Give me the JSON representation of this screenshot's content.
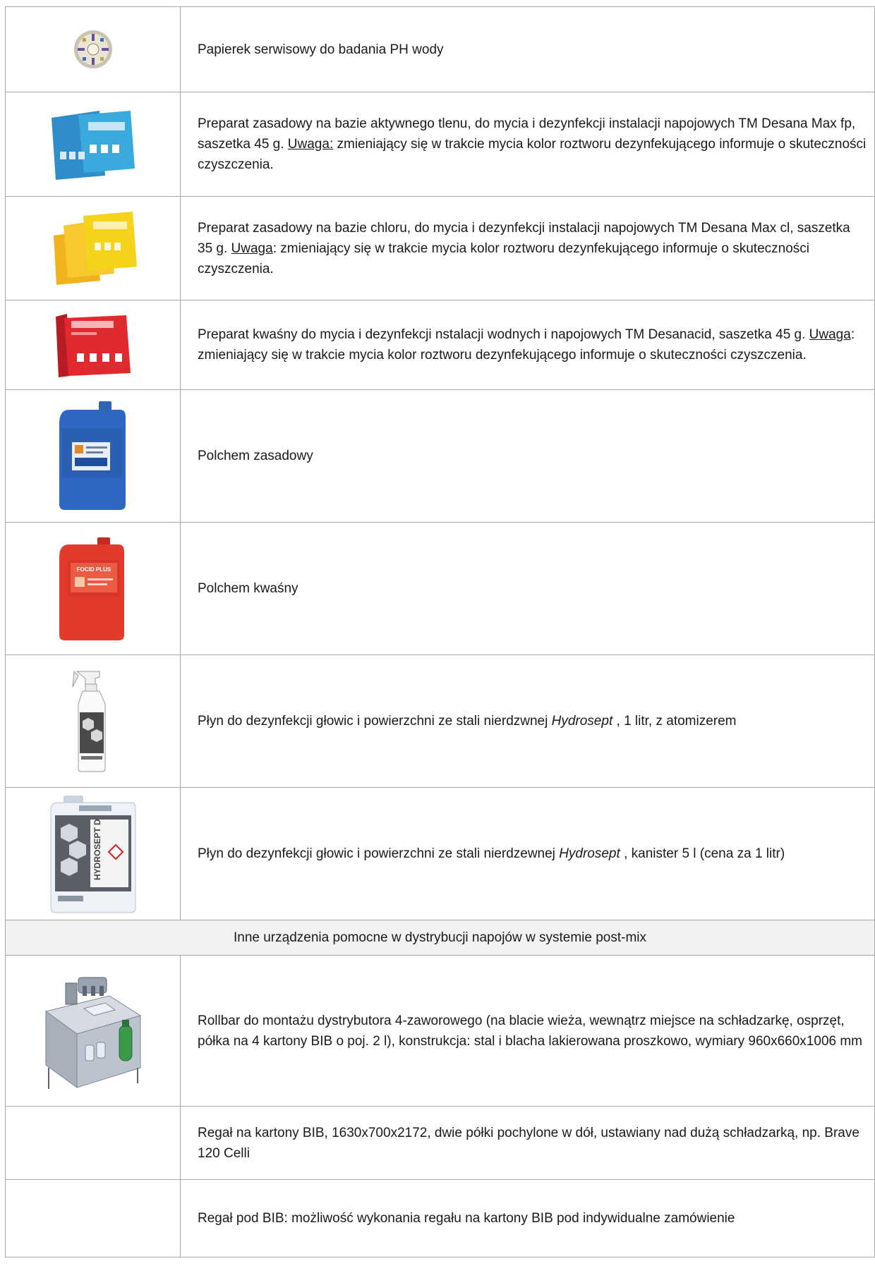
{
  "rows": [
    {
      "text": "Papierek serwisowy do badania PH wody",
      "image": "ph-test-paper-disc"
    },
    {
      "pre": "Preparat zasadowy na bazie aktywnego tlenu, do mycia i dezynfekcji instalacji napojowych TM Desana Max fp, saszetka 45 g. ",
      "u": "Uwaga:",
      "post": " zmieniający się w trakcie mycia kolor roztworu dezynfekującego informuje o skuteczności czyszczenia.",
      "image": "desana-max-fp-sachets"
    },
    {
      "pre": "Preparat zasadowy na bazie chloru, do mycia i dezynfekcji instalacji napojowych TM Desana Max cl, saszetka 35 g. ",
      "u": "Uwaga",
      "post": ": zmieniający się w trakcie mycia kolor roztworu dezynfekującego informuje o skuteczności czyszczenia.",
      "image": "desana-max-cl-sachets"
    },
    {
      "pre": "Preparat kwaśny do mycia i dezynfekcji nstalacji wodnych i napojowych TM Desanacid, saszetka 45 g. ",
      "u": "Uwaga",
      "post": ": zmieniający się w trakcie mycia kolor roztworu dezynfekującego informuje o skuteczności czyszczenia.",
      "image": "desanacid-sachet"
    },
    {
      "text": "Polchem zasadowy",
      "image": "blue-canister"
    },
    {
      "text": "Polchem kwaśny",
      "image": "red-canister",
      "canister_label": "FOCID PLUS"
    },
    {
      "pre": "Płyn do dezynfekcji głowic i powierzchni ze stali nierdzwnej ",
      "it": "Hydrosept",
      "post": " , 1 litr, z atomizerem",
      "image": "spray-bottle"
    },
    {
      "pre": "Płyn do dezynfekcji głowic i powierzchni ze stali nierdzewnej ",
      "it": "Hydrosept",
      "post": " , kanister 5 l (cena za 1 litr)",
      "image": "white-canister",
      "canister_label": "HYDROSEPT D"
    }
  ],
  "section": "Inne urządzenia pomocne w dystrybucji napojów w systemie post-mix",
  "rows2": [
    {
      "text": "Rollbar do montażu dystrybutora 4-zaworowego (na blacie wieża, wewnątrz miejsce na schładzarkę, osprzęt, półka na 4 kartony BIB o poj. 2 l), konstrukcja: stal i blacha lakierowana proszkowo, wymiary 960x660x1006 mm",
      "image": "rollbar-cabinet"
    },
    {
      "text": "Regał na kartony BIB, 1630x700x2172, dwie półki pochylone w dół, ustawiany nad dużą schładzarką, np. Brave 120 Celli"
    },
    {
      "text": "Regał pod BIB: możliwość wykonania regału na kartony BIB pod indywidualne zamówienie"
    }
  ],
  "colors": {
    "border": "#a6a6a6",
    "section_bg": "#f2f2f2"
  }
}
